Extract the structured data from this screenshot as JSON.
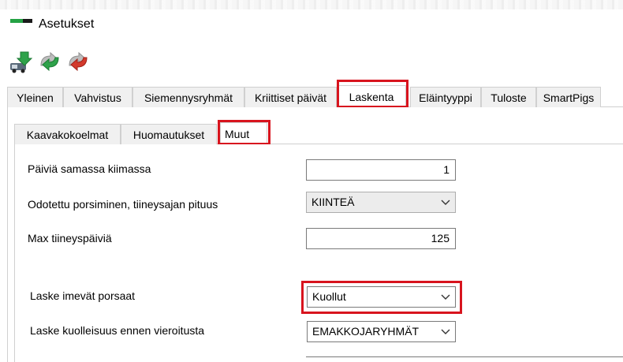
{
  "window": {
    "title": "Asetukset"
  },
  "toolbar": {
    "buttons": [
      {
        "icon": "truck-import-icon"
      },
      {
        "icon": "refresh-arrows-icon"
      },
      {
        "icon": "cancel-arrows-icon"
      }
    ]
  },
  "main_tabs": [
    "Yleinen",
    "Vahvistus",
    "Siemennysryhmät",
    "Kriittiset päivät",
    "Laskenta",
    "Eläintyyppi",
    "Tuloste",
    "SmartPigs"
  ],
  "main_tabs_active": "Laskenta",
  "sub_tabs": [
    "Kaavakokoelmat",
    "Huomautukset",
    "Muut"
  ],
  "sub_tabs_active": "Muut",
  "settings": {
    "same_heat_days": {
      "label": "Päiviä samassa kiimassa",
      "value": "1"
    },
    "expected_farrowing": {
      "label": "Odotettu porsiminen, tiineysajan pituus",
      "value": "KIINTEÄ"
    },
    "max_gestation_days": {
      "label": "Max tiineyspäiviä",
      "value": "125"
    },
    "count_suckling": {
      "label": "Laske imevät porsaat",
      "value": "Kuollut"
    },
    "count_mortality": {
      "label": "Laske kuolleisuus ennen vieroitusta",
      "value": "EMAKKOJARYHMÄT"
    }
  },
  "colors": {
    "highlight": "#d8141e",
    "brand_green": "#25a244"
  }
}
